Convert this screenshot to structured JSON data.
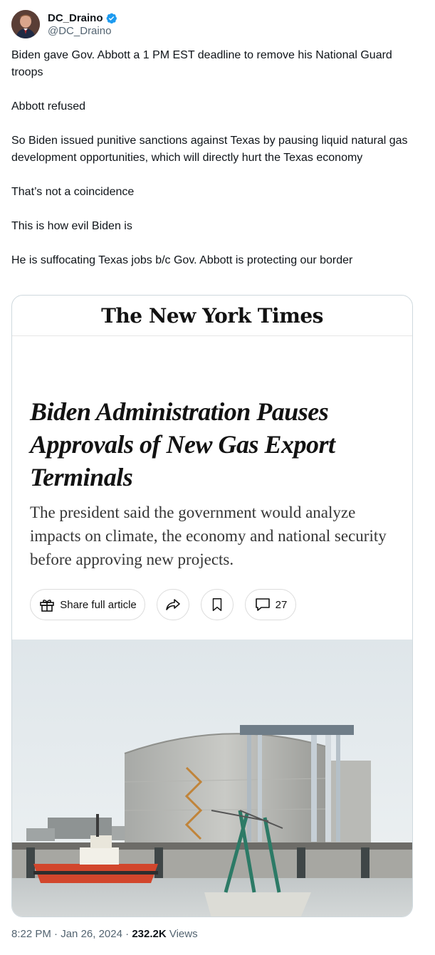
{
  "author": {
    "display_name": "DC_Draino",
    "handle": "@DC_Draino",
    "verified": true,
    "verified_color": "#1d9bf0"
  },
  "tweet": {
    "paragraphs": [
      "Biden gave Gov. Abbott a 1 PM EST deadline to remove his National Guard troops",
      "Abbott refused",
      "So Biden issued punitive sanctions against Texas by pausing liquid natural gas development opportunities, which will directly hurt the Texas economy",
      "That’s not a coincidence",
      "This is how evil Biden is",
      "He is suffocating Texas jobs b/c Gov. Abbott is protecting our border"
    ]
  },
  "card": {
    "masthead": "The New York Times",
    "headline": "Biden Administration Pauses Approvals of New Gas Export Terminals",
    "summary": "The president said the government would analyze impacts on climate, the economy and national security before approving new projects.",
    "share_label": "Share full article",
    "comment_count": "27",
    "icons": {
      "share": "gift-icon",
      "forward": "share-arrow-icon",
      "save": "bookmark-icon",
      "comments": "comment-icon"
    }
  },
  "meta": {
    "time": "8:22 PM",
    "separator": "·",
    "date": "Jan 26, 2024",
    "views_count": "232.2K",
    "views_label": "Views"
  }
}
